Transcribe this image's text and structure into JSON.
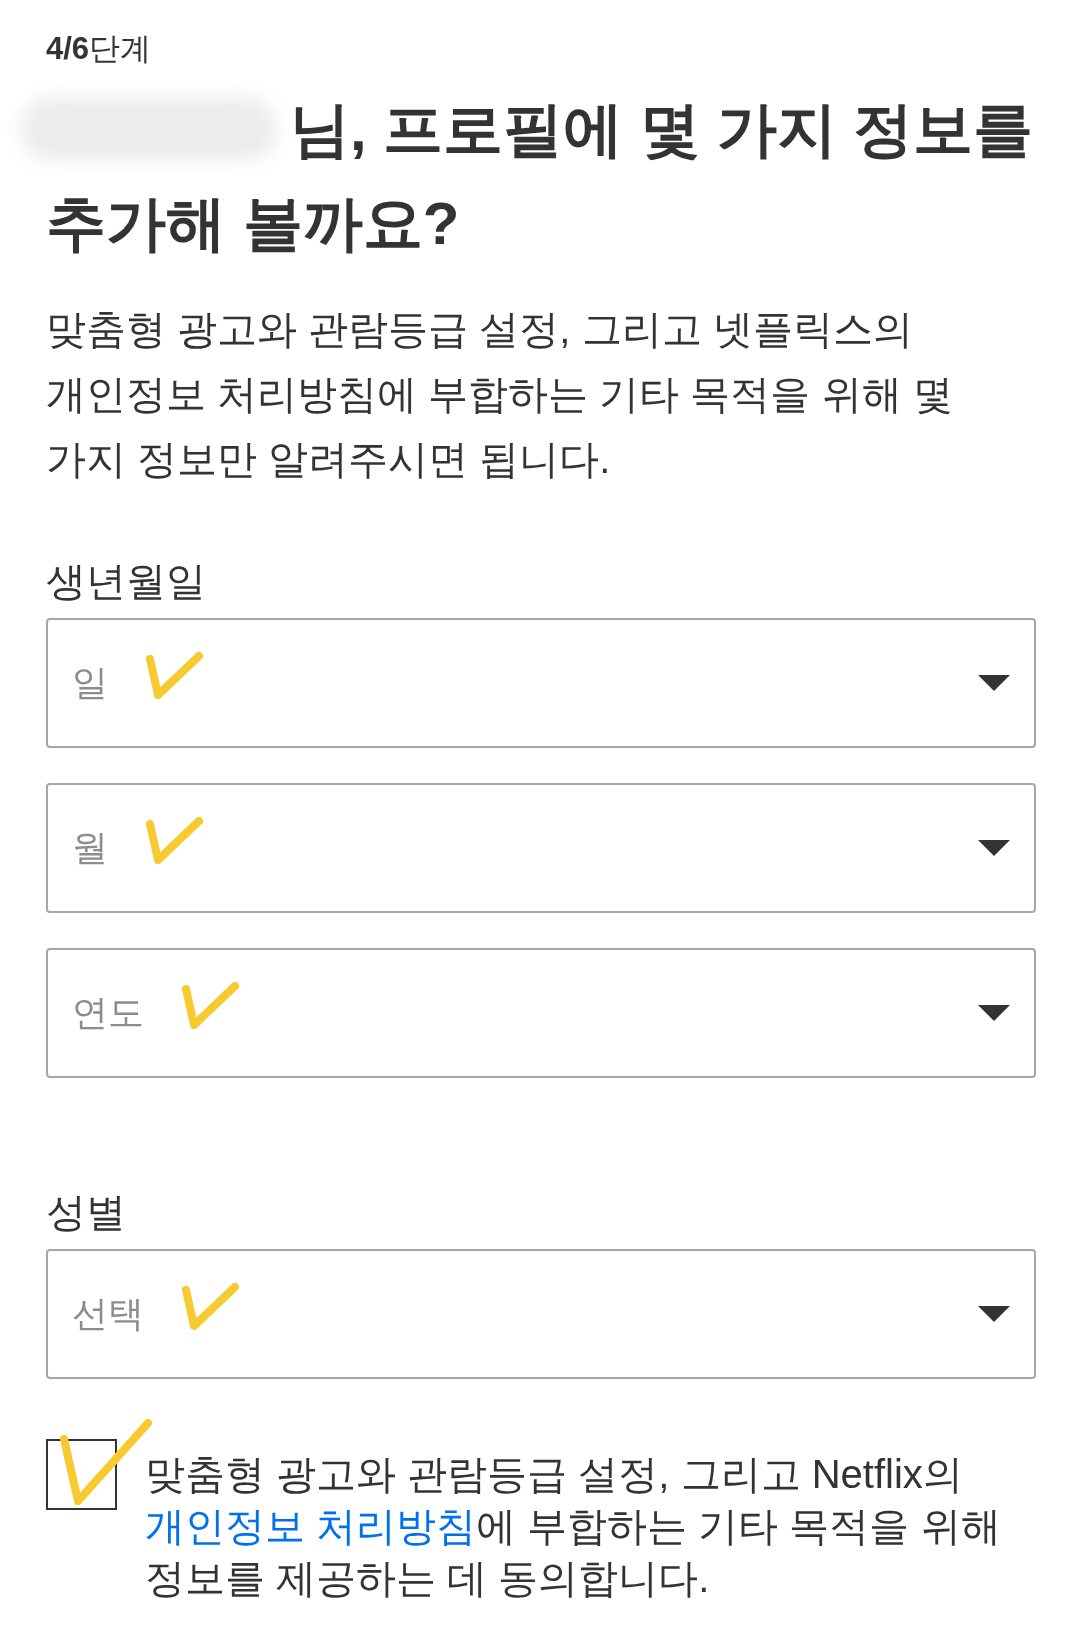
{
  "step": "**4/6**단계",
  "heading": {
    "name_redacted": true,
    "text": "님, 프로필에 몇 가지 정보를 추가해 볼까요?"
  },
  "intro": "맞춤형 광고와 관람등급 설정, 그리고 넷플릭스의 개인정보 처리방침에 부합하는 기타 목적을 위해 몇 가지 정보만 알려주시면 됩니다.",
  "sections": [
    {
      "label": "생년월일",
      "selects": [
        {
          "placeholder": "일",
          "hand_tick": true
        },
        {
          "placeholder": "월",
          "hand_tick": true
        },
        {
          "placeholder": "연도",
          "hand_tick": true
        }
      ]
    },
    {
      "label": "성별",
      "selects": [
        {
          "placeholder": "선택",
          "hand_tick": true
        }
      ]
    }
  ],
  "consent": {
    "checked": false,
    "hand_tick": true,
    "text_before": "맞춤형 광고와 관람등급 설정, 그리고 Netflix의",
    "link": "개인정보 처리방침",
    "text_after": "에 부합하는 기타 목적을 위해 정보를 제공하는 데 동의합니다."
  }
}
